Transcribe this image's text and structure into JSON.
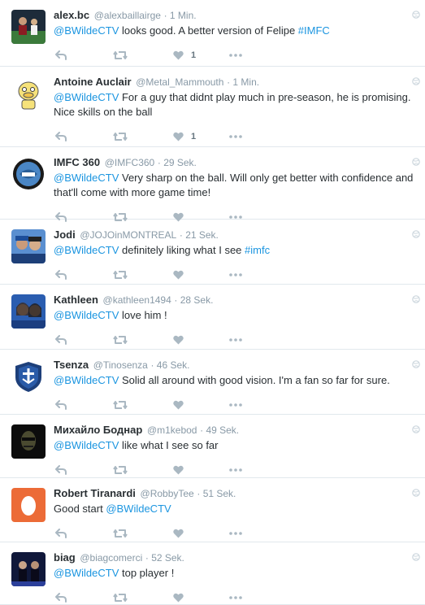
{
  "colors": {
    "link": "#1b95e0",
    "muted": "#8899a6",
    "icon": "#aab8c2",
    "divider": "#e1e8ed"
  },
  "tweets": [
    {
      "fullname": "alex.bc",
      "username": "@alexbaillairge",
      "time": "· 1 Min.",
      "mention": "@BWildeCTV",
      "text": " looks good. A better version of Felipe ",
      "hashtag": "#IMFC",
      "text_after": "",
      "like_count": "1",
      "avatar_icon": "soccer-player-avatar"
    },
    {
      "fullname": "Antoine Auclair",
      "username": "@Metal_Mammouth",
      "time": "· 1 Min.",
      "mention": "@BWildeCTV",
      "text": " For a guy that didnt play much in pre-season, he is promising. Nice skills on the ball",
      "hashtag": "",
      "text_after": "",
      "like_count": "1",
      "avatar_icon": "cartoon-duck-avatar"
    },
    {
      "fullname": "IMFC 360",
      "username": "@IMFC360",
      "time": "· 29 Sek.",
      "mention": "@BWildeCTV",
      "text": " Very sharp on the ball. Will only get better with confidence and that'll come with more game time!",
      "hashtag": "",
      "text_after": "",
      "like_count": "",
      "avatar_icon": "imfc360-logo-avatar"
    },
    {
      "fullname": "Jodi",
      "username": "@JOJOinMONTREAL",
      "time": "· 21 Sek.",
      "mention": "@BWildeCTV",
      "text": " definitely liking what I see ",
      "hashtag": "#imfc",
      "text_after": "",
      "like_count": "",
      "avatar_icon": "fans-photo-avatar"
    },
    {
      "fullname": "Kathleen",
      "username": "@kathleen1494",
      "time": "· 28 Sek.",
      "mention": "@BWildeCTV",
      "text": " love him !",
      "hashtag": "",
      "text_after": "",
      "like_count": "",
      "avatar_icon": "selfie-photo-avatar"
    },
    {
      "fullname": "Tsenza",
      "username": "@Tinosenza",
      "time": "· 46 Sek.",
      "mention": "@BWildeCTV",
      "text": " Solid all around with good vision. I'm a fan so far for sure.",
      "hashtag": "",
      "text_after": "",
      "like_count": "",
      "avatar_icon": "shield-crest-avatar"
    },
    {
      "fullname": "Михайло Боднар",
      "username": "@m1kebod",
      "time": "· 49 Sek.",
      "mention": "@BWildeCTV",
      "text": " like what I see so far",
      "hashtag": "",
      "text_after": "",
      "like_count": "",
      "avatar_icon": "dark-face-avatar"
    },
    {
      "fullname": "Robert Tiranardi",
      "username": "@RobbyTee",
      "time": "· 51 Sek.",
      "mention": "",
      "text": "Good start ",
      "hashtag": "",
      "text_after": "@BWildeCTV",
      "like_count": "",
      "avatar_icon": "default-egg-avatar"
    },
    {
      "fullname": "biag",
      "username": "@biagcomerci",
      "time": "· 52 Sek.",
      "mention": "@BWildeCTV",
      "text": " top player !",
      "hashtag": "",
      "text_after": "",
      "like_count": "",
      "avatar_icon": "stage-photo-avatar"
    }
  ]
}
